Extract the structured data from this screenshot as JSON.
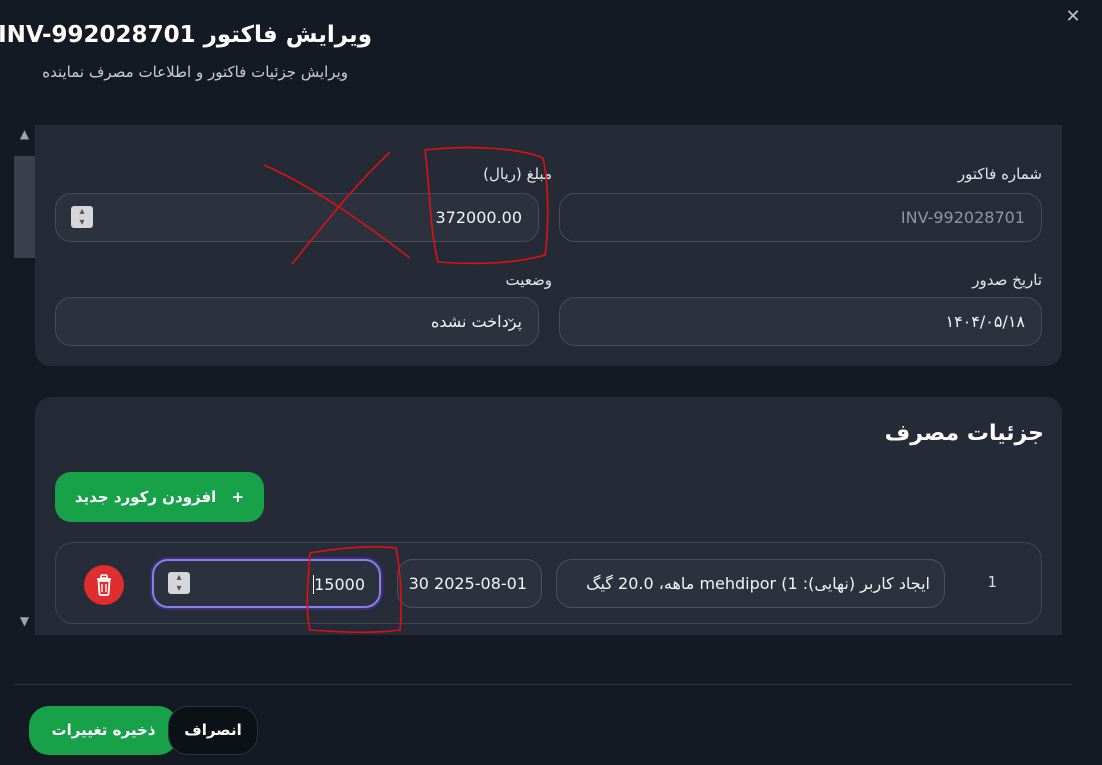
{
  "dialog": {
    "title": "ویرایش فاکتور INV-992028701",
    "subtitle": "ویرایش جزئیات فاکتور و اطلاعات مصرف نماینده",
    "close_glyph": "✕"
  },
  "invoice": {
    "number_label": "شماره فاکتور",
    "number_value": "INV-992028701",
    "amount_label": "مبلغ (ریال)",
    "amount_value": "372000.00",
    "issue_date_label": "تاریخ صدور",
    "issue_date_value": "۱۴۰۴/۰۵/۱۸",
    "status_label": "وضعیت",
    "status_value": "پرداخت نشده"
  },
  "usage": {
    "section_title": "جزئیات مصرف",
    "add_button_label": "افزودن رکورد جدید",
    "rows": [
      {
        "index": "1",
        "description": "ایجاد کاربر (نهایی): mehdipor (1 ماهه، 20.0 گیگ",
        "date": "2025-08-01 30",
        "amount": "15000"
      }
    ]
  },
  "footer": {
    "save_label": "ذخیره تغییرات",
    "cancel_label": "انصراف"
  },
  "icons": {
    "plus": "plus-icon",
    "trash": "trash-icon",
    "close": "close-icon",
    "chevron": "chevron-down-icon",
    "stepper": "stepper-icon"
  },
  "colors": {
    "background": "#141a24",
    "card": "#242b37",
    "accent_green": "#17a24a",
    "danger_red": "#e02d2d",
    "focus_purple": "#8b7cf0",
    "annotation_red": "#e01010"
  }
}
